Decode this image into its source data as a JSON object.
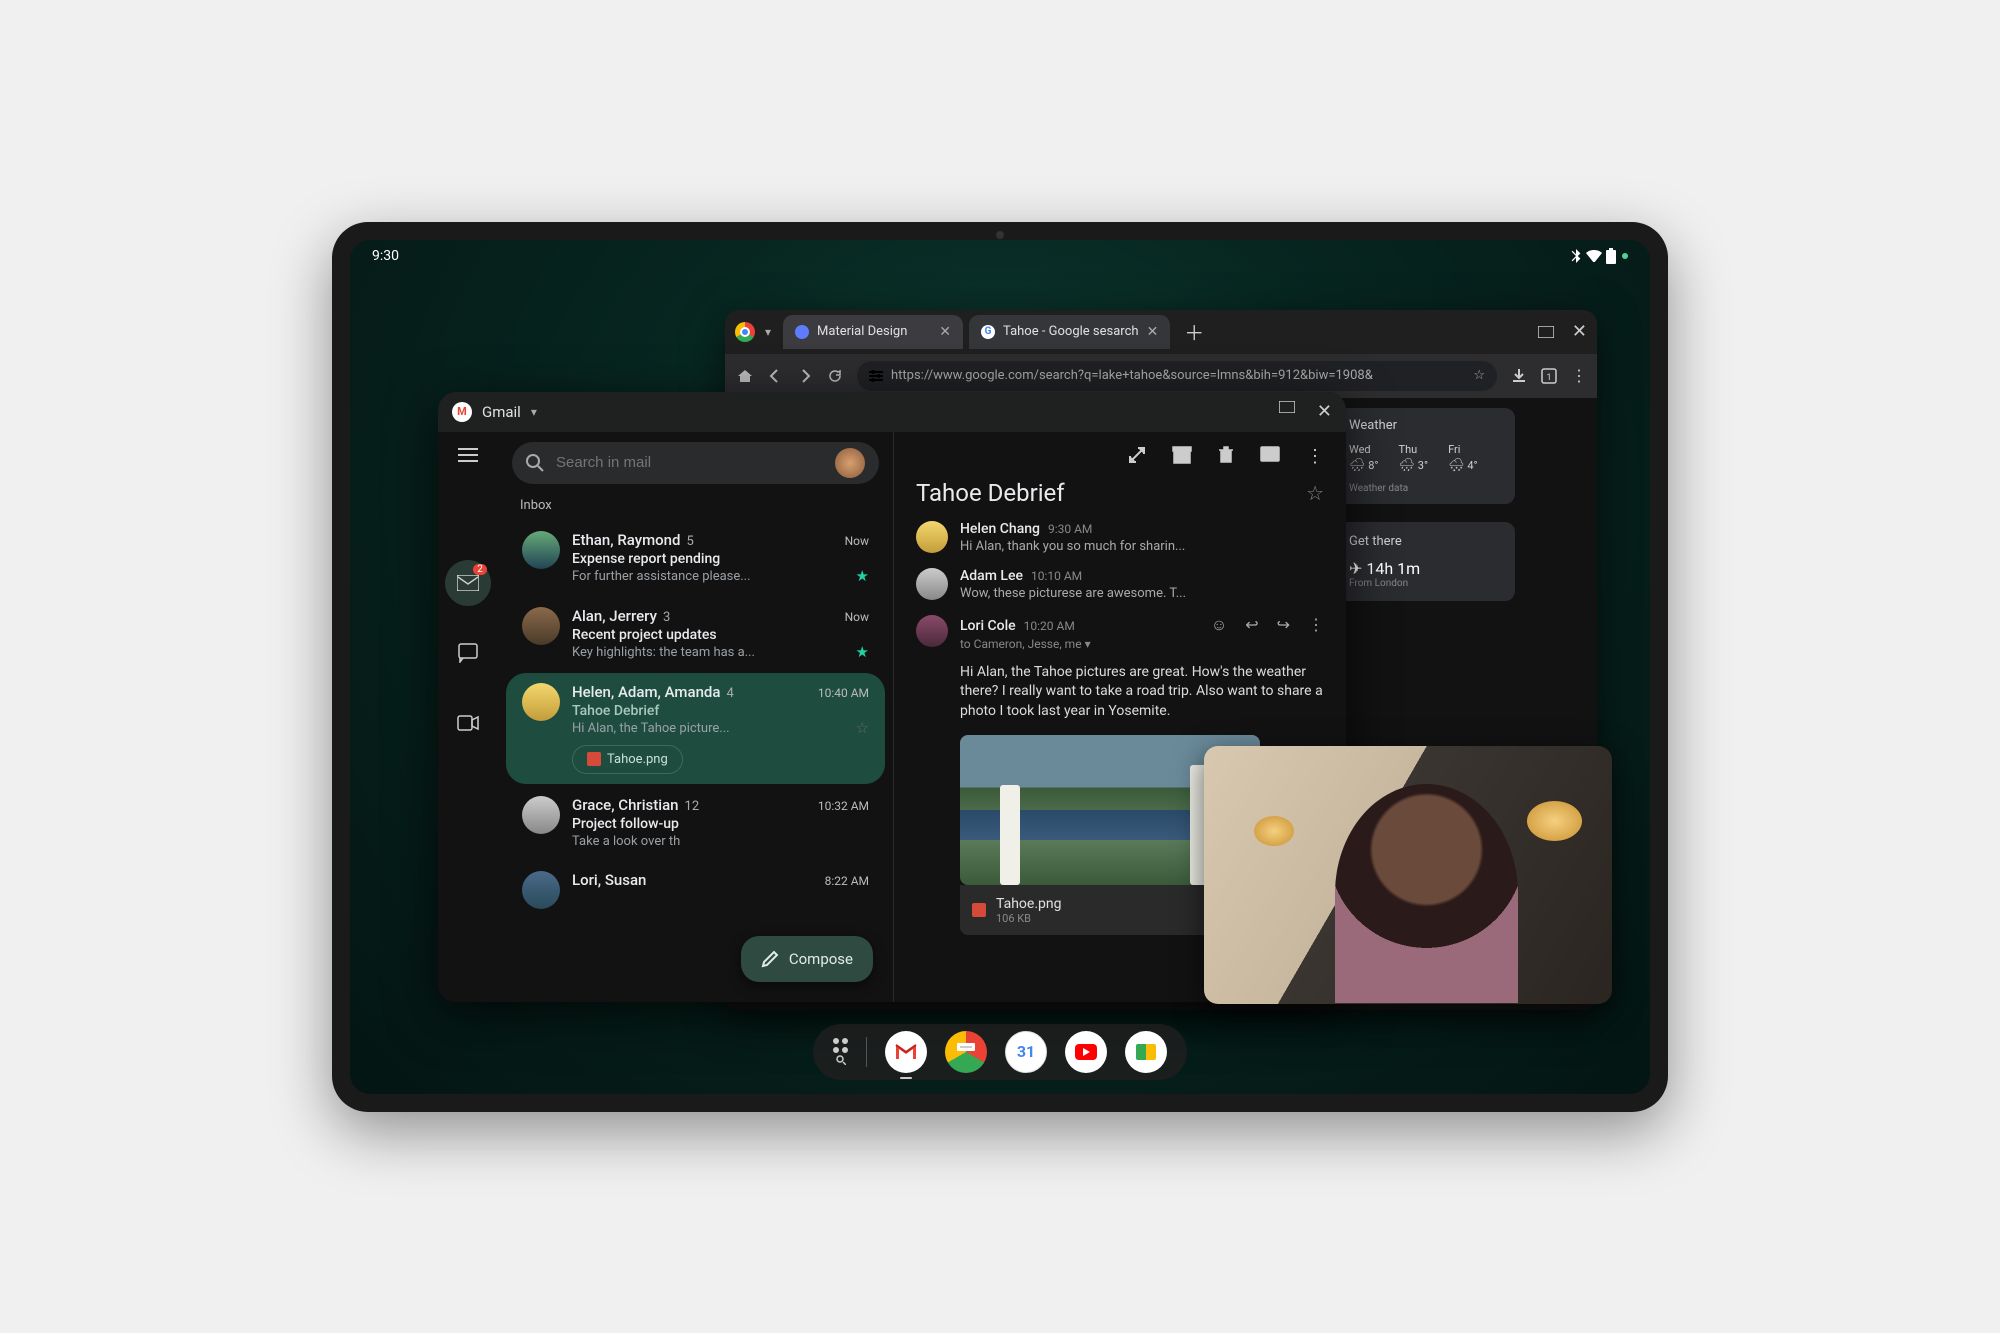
{
  "statusbar": {
    "time": "9:30"
  },
  "chrome": {
    "tabs": [
      {
        "title": "Material Design"
      },
      {
        "title": "Tahoe - Google sesarch"
      }
    ],
    "url": "https://www.google.com/search?q=lake+tahoe&source=lmns&bih=912&biw=1908&",
    "weather": {
      "title": "Weather",
      "days": [
        {
          "label": "Wed",
          "icon": "🌧",
          "temp": "8°"
        },
        {
          "label": "Thu",
          "icon": "🌧",
          "temp": "3°"
        },
        {
          "label": "Fri",
          "icon": "🌨",
          "temp": "4°"
        }
      ],
      "footer": "Weather data"
    },
    "travel": {
      "title": "Get there",
      "icon": "✈",
      "time": "14h 1m",
      "from": "From London"
    }
  },
  "gmail": {
    "title": "Gmail",
    "search_placeholder": "Search in mail",
    "inbox_label": "Inbox",
    "sidebar": {
      "badge": "2"
    },
    "threads": [
      {
        "senders": "Ethan, Raymond",
        "count": "5",
        "time": "Now",
        "subject": "Expense report pending",
        "snippet": "For further assistance please...",
        "starred": true
      },
      {
        "senders": "Alan, Jerrery",
        "count": "3",
        "time": "Now",
        "subject": "Recent project updates",
        "snippet": "Key highlights: the team has a...",
        "starred": true
      },
      {
        "senders": "Helen, Adam, Amanda",
        "count": "4",
        "time": "10:40 AM",
        "subject": "Tahoe Debrief",
        "snippet": "Hi Alan, the Tahoe picture...",
        "attachment": "Tahoe.png",
        "selected": true
      },
      {
        "senders": "Grace, Christian",
        "count": "12",
        "time": "10:32 AM",
        "subject": "Project follow-up",
        "snippet": "Take a look over th"
      },
      {
        "senders": "Lori, Susan",
        "count": "",
        "time": "8:22 AM",
        "subject": "",
        "snippet": ""
      }
    ],
    "compose": "Compose",
    "detail": {
      "subject": "Tahoe Debrief",
      "messages": [
        {
          "sender": "Helen Chang",
          "time": "9:30 AM",
          "snippet": "Hi Alan, thank you so much for sharin..."
        },
        {
          "sender": "Adam Lee",
          "time": "10:10 AM",
          "snippet": "Wow, these picturese are awesome. T..."
        },
        {
          "sender": "Lori Cole",
          "time": "10:20 AM",
          "recipients": "to Cameron, Jesse, me",
          "body": "Hi Alan, the Tahoe pictures are great. How's the weather there? I really want to take a road trip. Also want to share a photo I took last year in Yosemite.",
          "attachment_name": "Tahoe.png",
          "attachment_size": "106 KB"
        }
      ]
    }
  },
  "taskbar": {
    "calendar_day": "31"
  }
}
